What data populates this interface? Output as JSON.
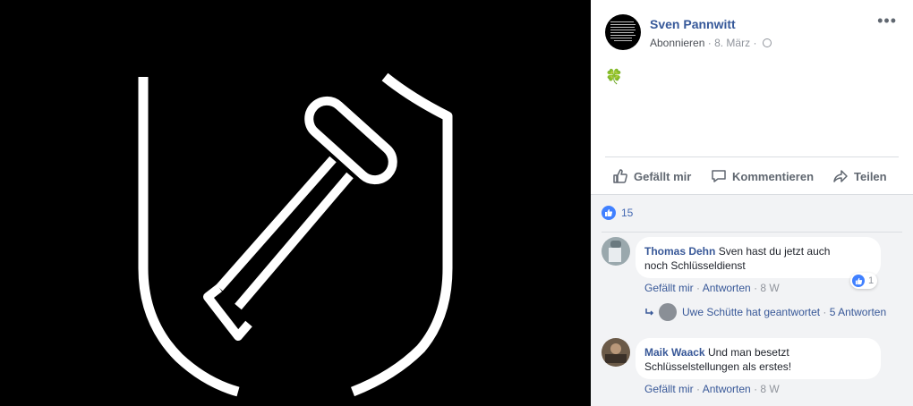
{
  "post": {
    "author": "Sven Pannwitt",
    "follow_label": "Abonnieren",
    "date": "8. März",
    "text_emoji": "🍀"
  },
  "actions": {
    "like": "Gefällt mir",
    "comment": "Kommentieren",
    "share": "Teilen"
  },
  "reactions": {
    "count": "15"
  },
  "comments": [
    {
      "author": "Thomas Dehn",
      "text_line1": "Sven hast du jetzt auch",
      "text_line2": "noch Schlüsseldienst",
      "like": "Gefällt mir",
      "reply": "Antworten",
      "age": "8 W",
      "reaction_count": "1",
      "replies_note": "Uwe Schütte hat geantwortet",
      "replies_count": "5 Antworten"
    },
    {
      "author": "Maik Waack",
      "text_line1": "Und man besetzt",
      "text_line2": "Schlüsselstellungen als erstes!",
      "like": "Gefällt mir",
      "reply": "Antworten",
      "age": "8 W"
    }
  ],
  "colors": {
    "link": "#365899",
    "muted": "#90949c",
    "like_blue": "#4080ff",
    "panel_bg": "#f2f3f5"
  }
}
